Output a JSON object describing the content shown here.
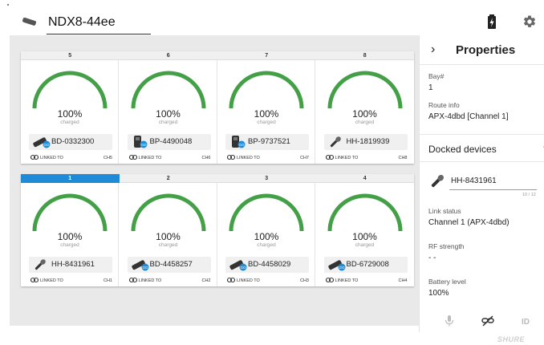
{
  "header": {
    "device_name": "NDX8-44ee"
  },
  "groups": [
    {
      "bays": [
        {
          "bay": "5",
          "active": false,
          "percent": "100%",
          "status": "charged",
          "device_type": "bodypack",
          "device": "BD-0332300",
          "linked_label": "LINKED TO",
          "channel": "CH5",
          "level": 1.0
        },
        {
          "bay": "6",
          "active": false,
          "percent": "100%",
          "status": "charged",
          "device_type": "boundary",
          "device": "BP-4490048",
          "linked_label": "LINKED TO",
          "channel": "CH6",
          "level": 1.0
        },
        {
          "bay": "7",
          "active": false,
          "percent": "100%",
          "status": "charged",
          "device_type": "boundary",
          "device": "BP-9737521",
          "linked_label": "LINKED TO",
          "channel": "CH7",
          "level": 1.0
        },
        {
          "bay": "8",
          "active": false,
          "percent": "100%",
          "status": "charged",
          "device_type": "handheld",
          "device": "HH-1819939",
          "linked_label": "LINKED TO",
          "channel": "CH8",
          "level": 1.0
        }
      ]
    },
    {
      "bays": [
        {
          "bay": "1",
          "active": true,
          "percent": "100%",
          "status": "charged",
          "device_type": "handheld",
          "device": "HH-8431961",
          "linked_label": "LINKED TO",
          "channel": "CH1",
          "level": 1.0
        },
        {
          "bay": "2",
          "active": false,
          "percent": "100%",
          "status": "charged",
          "device_type": "bodypack",
          "device": "BD-4458257",
          "linked_label": "LINKED TO",
          "channel": "CH2",
          "level": 1.0
        },
        {
          "bay": "3",
          "active": false,
          "percent": "100%",
          "status": "charged",
          "device_type": "bodypack",
          "device": "BD-4458029",
          "linked_label": "LINKED TO",
          "channel": "CH3",
          "level": 1.0
        },
        {
          "bay": "4",
          "active": false,
          "percent": "100%",
          "status": "charged",
          "device_type": "bodypack",
          "device": "BD-6729008",
          "linked_label": "LINKED TO",
          "channel": "CH4",
          "level": 1.0
        }
      ]
    }
  ],
  "properties": {
    "title": "Properties",
    "bay_label": "Bay#",
    "bay_value": "1",
    "route_label": "Route info",
    "route_value": "APX-4dbd [Channel 1]",
    "docked_title": "Docked devices",
    "docked_device": "HH-8431961",
    "char_counter": "10 / 12",
    "link_status_label": "Link status",
    "link_status_value": "Channel 1 (APX-4dbd)",
    "rf_label": "RF strength",
    "rf_value": "- -",
    "battery_label": "Battery level",
    "battery_value": "100%",
    "id_button": "ID"
  },
  "brand": "SHURE",
  "colors": {
    "gauge": "#43a047",
    "active_bay": "#1f8bd6",
    "link_badge": "#1f8bd6"
  },
  "icons": [
    "device-icon",
    "battery-charging-icon",
    "gear-icon",
    "chevron-right-icon",
    "link-icon",
    "microphone-icon",
    "unlink-icon",
    "bodypack-icon",
    "boundary-icon",
    "handheld-mic-icon"
  ]
}
